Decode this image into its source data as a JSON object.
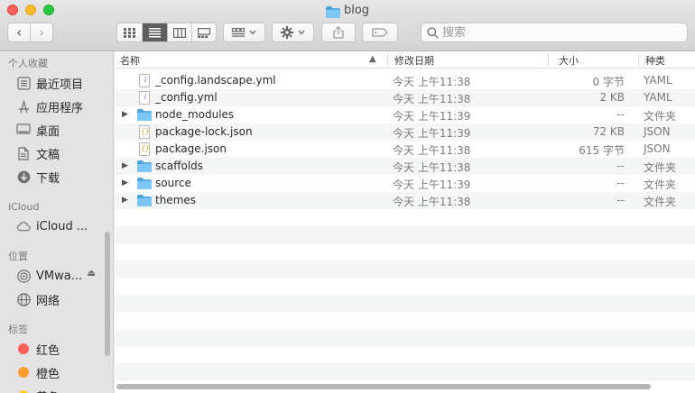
{
  "window": {
    "title": "blog"
  },
  "toolbar": {
    "back_glyph": "‹",
    "forward_glyph": "›",
    "search": {
      "placeholder": "搜索",
      "value": ""
    }
  },
  "sidebar": {
    "sections": [
      {
        "heading": "个人收藏",
        "items": [
          {
            "label": "最近项目",
            "icon": "recents-icon"
          },
          {
            "label": "应用程序",
            "icon": "applications-icon"
          },
          {
            "label": "桌面",
            "icon": "desktop-icon"
          },
          {
            "label": "文稿",
            "icon": "documents-icon"
          },
          {
            "label": "下载",
            "icon": "downloads-icon"
          }
        ]
      },
      {
        "heading": "iCloud",
        "items": [
          {
            "label": "iCloud ...",
            "icon": "icloud-icon"
          }
        ]
      },
      {
        "heading": "位置",
        "items": [
          {
            "label": "VMwa...",
            "icon": "disk-icon"
          },
          {
            "label": "网络",
            "icon": "network-icon"
          }
        ]
      },
      {
        "heading": "标签",
        "items": [
          {
            "label": "红色",
            "color": "#fe5f57"
          },
          {
            "label": "橙色",
            "color": "#fd9e2e"
          },
          {
            "label": "黄色",
            "color": "#fccd2f"
          }
        ]
      }
    ]
  },
  "columns": {
    "name": "名称",
    "date": "修改日期",
    "size": "大小",
    "kind": "种类"
  },
  "files": [
    {
      "name": "_config.landscape.yml",
      "date": "今天 上午11:38",
      "size": "0 字节",
      "kind": "YAML",
      "type": "yaml"
    },
    {
      "name": "_config.yml",
      "date": "今天 上午11:38",
      "size": "2 KB",
      "kind": "YAML",
      "type": "yaml"
    },
    {
      "name": "node_modules",
      "date": "今天 上午11:39",
      "size": "--",
      "kind": "文件夹",
      "type": "folder"
    },
    {
      "name": "package-lock.json",
      "date": "今天 上午11:39",
      "size": "72 KB",
      "kind": "JSON",
      "type": "json"
    },
    {
      "name": "package.json",
      "date": "今天 上午11:38",
      "size": "615 字节",
      "kind": "JSON",
      "type": "json"
    },
    {
      "name": "scaffolds",
      "date": "今天 上午11:38",
      "size": "--",
      "kind": "文件夹",
      "type": "folder"
    },
    {
      "name": "source",
      "date": "今天 上午11:39",
      "size": "--",
      "kind": "文件夹",
      "type": "folder"
    },
    {
      "name": "themes",
      "date": "今天 上午11:38",
      "size": "--",
      "kind": "文件夹",
      "type": "folder"
    }
  ],
  "colors": {
    "folder": "#7cc6f5",
    "accent": "#5e5e5e",
    "yaml_mark": "#8e44ad",
    "json_mark": "#c9a227"
  }
}
